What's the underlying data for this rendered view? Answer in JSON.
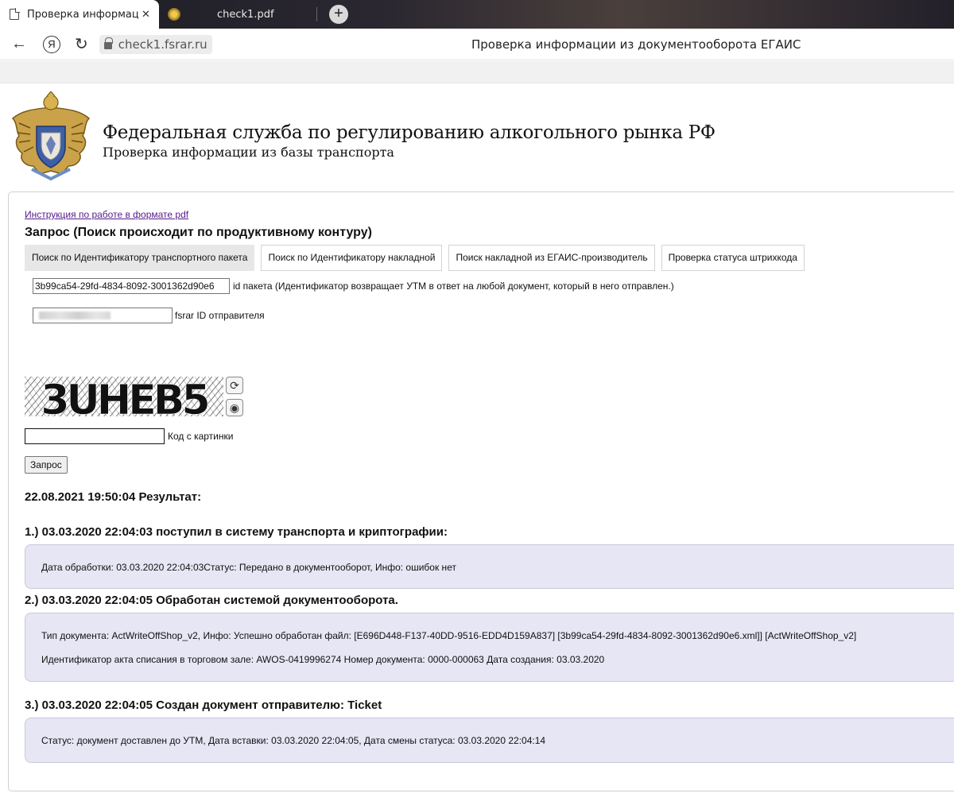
{
  "browser": {
    "active_tab_title": "Проверка информации",
    "tab2_title": "check1.pdf",
    "url": "check1.fsrar.ru",
    "window_title": "Проверка информации из документооборота ЕГАИС",
    "new_tab_symbol": "+",
    "close_symbol": "✕",
    "back_symbol": "←",
    "ya_symbol": "Я",
    "reload_symbol": "↻"
  },
  "header": {
    "org_name": "Федеральная служба по регулированию алкогольного рынка РФ",
    "subtitle": "Проверка информации из базы транспорта"
  },
  "form": {
    "pdf_link": "Инструкция по работе в формате pdf",
    "title": "Запрос (Поиск происходит по продуктивному контуру)",
    "tabs": [
      {
        "label": "Поиск по Идентификатору транспортного пакета"
      },
      {
        "label": "Поиск по Идентификатору накладной"
      },
      {
        "label": "Поиск накладной из ЕГАИС-производитель"
      },
      {
        "label": "Проверка статуса штрихкода"
      }
    ],
    "packet_id_value": "3b99ca54-29fd-4834-8092-3001362d90e6",
    "packet_id_label": "id пакета (Идентификатор возвращает УТМ в ответ на любой документ, который в него отправлен.)",
    "fsrar_id_label": "fsrar ID отправителя",
    "captcha_text": "3UHEB5",
    "captcha_label": "Код с картинки",
    "submit_label": "Запрос"
  },
  "result": {
    "heading": "22.08.2021 19:50:04 Результат:",
    "steps": [
      {
        "heading": "1.) 03.03.2020 22:04:03 поступил в систему транспорта и криптографии:",
        "lines": [
          "Дата обработки: 03.03.2020 22:04:03Статус: Передано в документооборот, Инфо: ошибок нет"
        ]
      },
      {
        "heading": "2.) 03.03.2020 22:04:05 Обработан системой документооборота.",
        "lines": [
          "Тип документа: ActWriteOffShop_v2, Инфо: Успешно обработан файл: [E696D448-F137-40DD-9516-EDD4D159A837] [3b99ca54-29fd-4834-8092-3001362d90e6.xml]] [ActWriteOffShop_v2]",
          "Идентификатор акта списания в торговом зале: AWOS-0419996274 Номер документа: 0000-000063 Дата создания: 03.03.2020"
        ]
      },
      {
        "heading": "3.) 03.03.2020 22:04:05 Создан документ отправителю: Ticket",
        "lines": [
          "Статус: документ доставлен до УТМ, Дата вставки: 03.03.2020 22:04:05, Дата смены статуса: 03.03.2020 22:04:14"
        ]
      }
    ]
  }
}
